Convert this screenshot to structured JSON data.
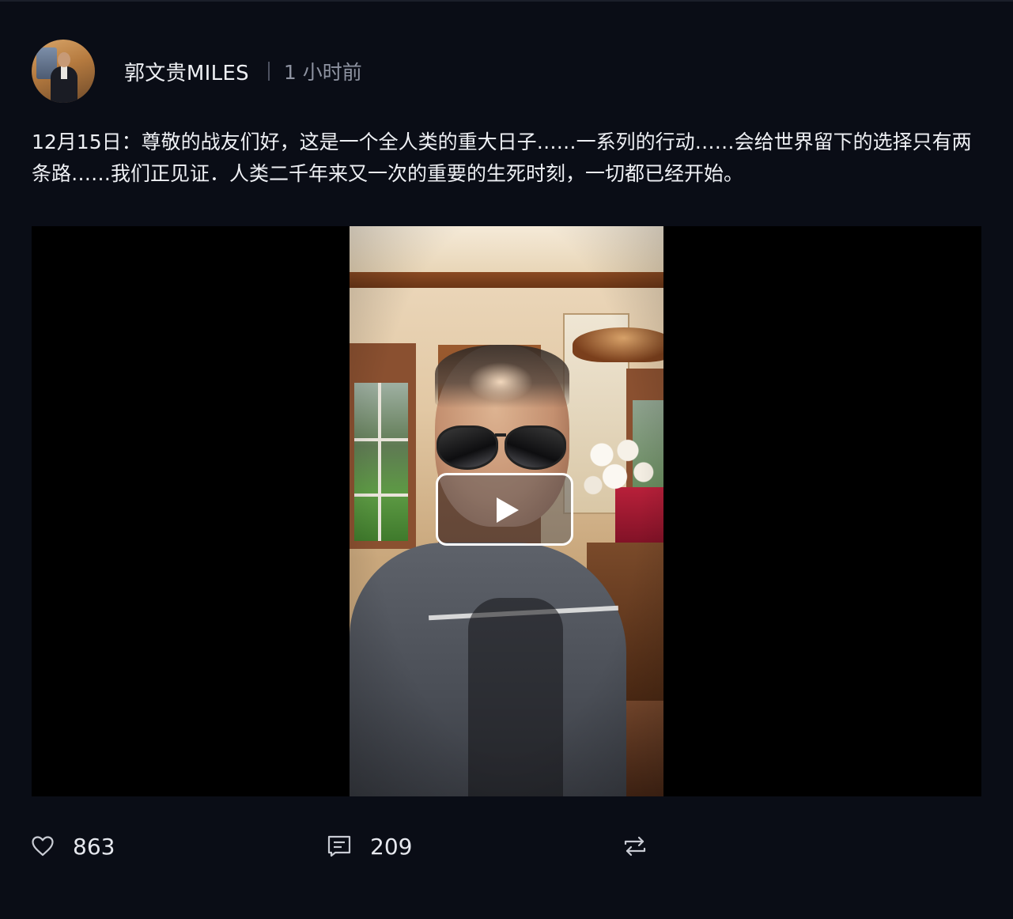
{
  "post": {
    "author": "郭文贵MILES",
    "timestamp": "1 小时前",
    "text": "12月15日：尊敬的战友们好，这是一个全人类的重大日子……一系列的行动……会给世界留下的选择只有两条路……我们正见证．人类二千年来又一次的重要的生死时刻，一切都已经开始。",
    "video": {
      "play_icon": "play-icon"
    },
    "actions": {
      "likes": "863",
      "comments": "209",
      "like_icon": "heart-outline-icon",
      "comment_icon": "comment-icon",
      "repost_icon": "repost-icon"
    }
  },
  "colors": {
    "background": "#0a0d16",
    "text": "#eef0f4",
    "muted": "#8e93a1"
  }
}
